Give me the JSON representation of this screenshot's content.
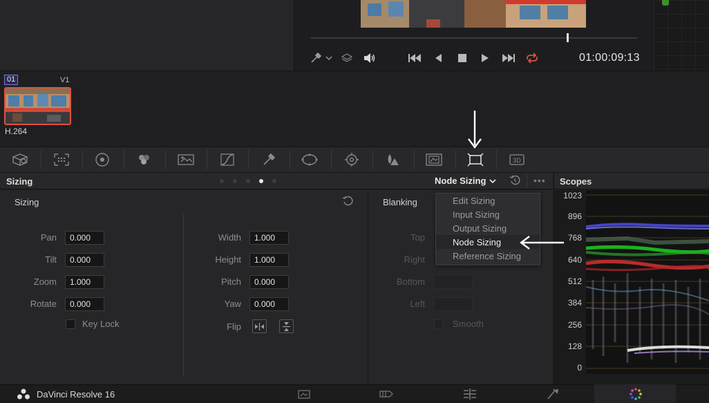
{
  "viewer": {
    "timecode": "01:00:09:13",
    "progress": 0.78,
    "controls": [
      "picker-icon",
      "layers-icon",
      "speaker-icon",
      "skip-start-icon",
      "step-back-icon",
      "stop-icon",
      "play-icon",
      "skip-end-icon",
      "loop-icon"
    ]
  },
  "clip": {
    "number": "01",
    "track": "V1",
    "codec": "H.264"
  },
  "palette": {
    "icons": [
      "camera-raw-icon",
      "color-match-icon",
      "color-wheels-icon",
      "rgb-mixer-icon",
      "motion-effects-icon",
      "curves-icon",
      "qualifier-icon",
      "window-icon",
      "tracker-icon",
      "blur-icon",
      "key-icon",
      "sizing-icon",
      "3d-icon"
    ],
    "active": "sizing-icon"
  },
  "panel": {
    "title": "Sizing",
    "mode_label": "Node Sizing",
    "active_dot": 3
  },
  "sizing": {
    "section_title": "Sizing",
    "pan_label": "Pan",
    "pan": "0.000",
    "tilt_label": "Tilt",
    "tilt": "0.000",
    "zoom_label": "Zoom",
    "zoom": "1.000",
    "rotate_label": "Rotate",
    "rotate": "0.000",
    "keylock_label": "Key Lock",
    "width_label": "Width",
    "width": "1.000",
    "height_label": "Height",
    "height": "1.000",
    "pitch_label": "Pitch",
    "pitch": "0.000",
    "yaw_label": "Yaw",
    "yaw": "0.000",
    "flip_label": "Flip"
  },
  "blanking": {
    "title": "Blanking",
    "top_label": "Top",
    "right_label": "Right",
    "bottom_label": "Bottom",
    "left_label": "Left",
    "smooth_label": "Smooth"
  },
  "menu": {
    "items": [
      "Edit Sizing",
      "Input Sizing",
      "Output Sizing",
      "Node Sizing",
      "Reference Sizing"
    ],
    "selected": "Node Sizing"
  },
  "scopes": {
    "title": "Scopes",
    "scale": [
      "1023",
      "896",
      "768",
      "640",
      "512",
      "384",
      "256",
      "128",
      "0"
    ]
  },
  "footer": {
    "app_name": "DaVinci Resolve 16",
    "pages": [
      "media-icon",
      "cut-icon",
      "edit-icon",
      "fusion-icon",
      "color-icon"
    ],
    "active_page": "color-icon"
  },
  "colors": {
    "accent_red": "#e0503f",
    "loop_red": "#e0503f",
    "annotation": "#ffffff"
  }
}
